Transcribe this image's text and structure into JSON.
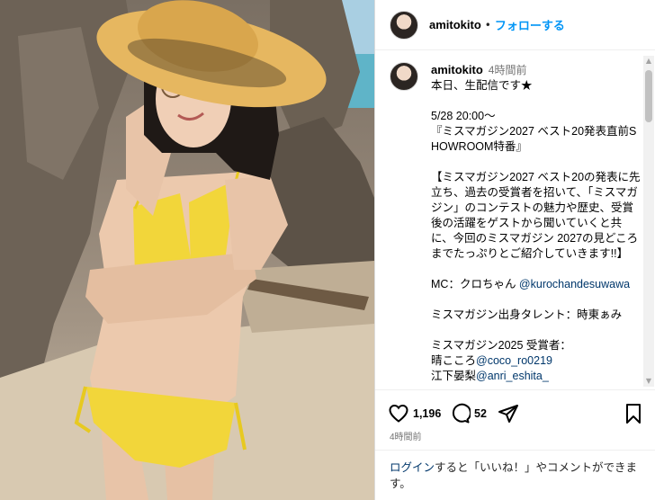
{
  "post": {
    "username": "amitokito",
    "follow_label": "フォローする",
    "separator": "•"
  },
  "caption": {
    "username": "amitokito",
    "time_ago": "4時間前",
    "lines": [
      "本日、生配信です★",
      "",
      "5/28 20:00〜",
      "『ミスマガジン2027 ベスト20発表直前SHOWROOM特番』",
      "",
      "【ミスマガジン2027 ベスト20の発表に先立ち、過去の受賞者を招いて、「ミスマガジン」のコンテストの魅力や歴史、受賞後の活躍をゲストから聞いていくと共に、今回のミスマガジン 2027の見どころまでたっぷりとご紹介していきます!!】",
      "",
      "MC：クロちゃん ",
      "",
      "ミスマガジン出身タレント：時東ぁみ",
      "",
      "ミスマガジン2025 受賞者：",
      "晴こころ",
      "江下晏梨"
    ],
    "mc_mention": "@kurochandesuwawa",
    "mention_haru": "@coco_ro0219",
    "mention_eshita": "@anri_eshita_"
  },
  "actions": {
    "like_icon": "heart-icon",
    "like_count": "1,196",
    "comment_icon": "comment-icon",
    "comment_count": "52",
    "share_icon": "paper-plane-icon",
    "save_icon": "bookmark-icon"
  },
  "post_time": "4時間前",
  "login": {
    "link_text": "ログイン",
    "rest_text": "すると「いいね！」やコメントができます。"
  },
  "colors": {
    "link_blue": "#0095f6",
    "mention_blue": "#00376b",
    "meta_gray": "#737373",
    "divider": "#efefef"
  }
}
